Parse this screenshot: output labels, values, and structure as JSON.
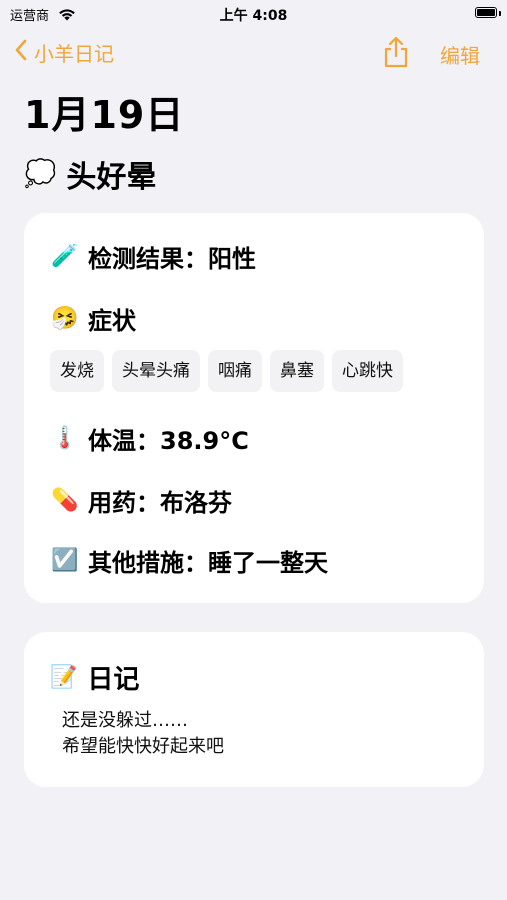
{
  "status_bar": {
    "carrier": "运营商",
    "time": "上午 4:08"
  },
  "nav": {
    "back_label": "小羊日记",
    "edit_label": "编辑",
    "accent_color": "#f0a63b"
  },
  "entry": {
    "date": "1月19日",
    "mood_emoji": "💭",
    "mood_title": "头好晕"
  },
  "details": {
    "test": {
      "emoji": "🧪",
      "label": "检测结果：阳性"
    },
    "symptoms": {
      "emoji": "🤧",
      "label": "症状",
      "tags": [
        "发烧",
        "头晕头痛",
        "咽痛",
        "鼻塞",
        "心跳快"
      ]
    },
    "temperature": {
      "emoji": "🌡️",
      "label": "体温：38.9°C"
    },
    "medicine": {
      "emoji": "💊",
      "label": "用药：布洛芬"
    },
    "other": {
      "emoji": "☑️",
      "label": "其他措施：睡了一整天"
    }
  },
  "diary": {
    "emoji": "📝",
    "title": "日记",
    "lines": [
      "还是没躲过……",
      "希望能快快好起来吧"
    ]
  }
}
